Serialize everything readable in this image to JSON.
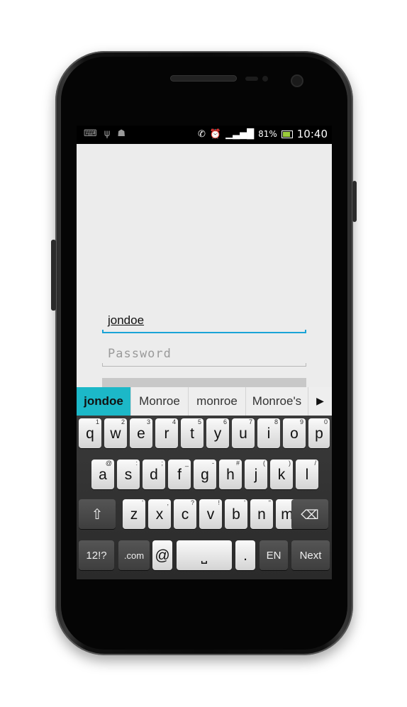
{
  "status_bar": {
    "left_icons": [
      "keyboard-icon",
      "usb-icon",
      "android-debug-icon"
    ],
    "right_icons": [
      "call-icon",
      "alarm-icon",
      "signal-icon",
      "battery-icon"
    ],
    "battery_percent": "81%",
    "time": "10:40"
  },
  "login": {
    "username_value": "jondoe",
    "password_placeholder": "Password"
  },
  "suggestions": {
    "items": [
      "jondoe",
      "Monroe",
      "monroe",
      "Monroe's"
    ],
    "more_arrow": "▶"
  },
  "keyboard": {
    "row1": [
      {
        "label": "q",
        "hint": "1"
      },
      {
        "label": "w",
        "hint": "2"
      },
      {
        "label": "e",
        "hint": "3"
      },
      {
        "label": "r",
        "hint": "4"
      },
      {
        "label": "t",
        "hint": "5"
      },
      {
        "label": "y",
        "hint": "6"
      },
      {
        "label": "u",
        "hint": "7"
      },
      {
        "label": "i",
        "hint": "8"
      },
      {
        "label": "o",
        "hint": "9"
      },
      {
        "label": "p",
        "hint": "0"
      }
    ],
    "row2": [
      {
        "label": "a",
        "hint": "@"
      },
      {
        "label": "s",
        "hint": ":"
      },
      {
        "label": "d",
        "hint": ";"
      },
      {
        "label": "f",
        "hint": "_"
      },
      {
        "label": "g",
        "hint": "-"
      },
      {
        "label": "h",
        "hint": "#"
      },
      {
        "label": "j",
        "hint": "("
      },
      {
        "label": "k",
        "hint": ")"
      },
      {
        "label": "l",
        "hint": "/"
      }
    ],
    "row3": [
      {
        "label": "z",
        "hint": "'"
      },
      {
        "label": "x",
        "hint": ","
      },
      {
        "label": "c",
        "hint": "?"
      },
      {
        "label": "v",
        "hint": "!"
      },
      {
        "label": "b",
        "hint": "'"
      },
      {
        "label": "n",
        "hint": "\""
      },
      {
        "label": "m",
        "hint": "\\"
      }
    ],
    "shift_icon": "⇧",
    "delete_icon": "⌫",
    "symbols_label": "12!?",
    "dotcom_label": ".com",
    "at_label": "@",
    "space_icon": "⎵",
    "period_label": ".",
    "language_label": "EN",
    "next_label": "Next"
  }
}
